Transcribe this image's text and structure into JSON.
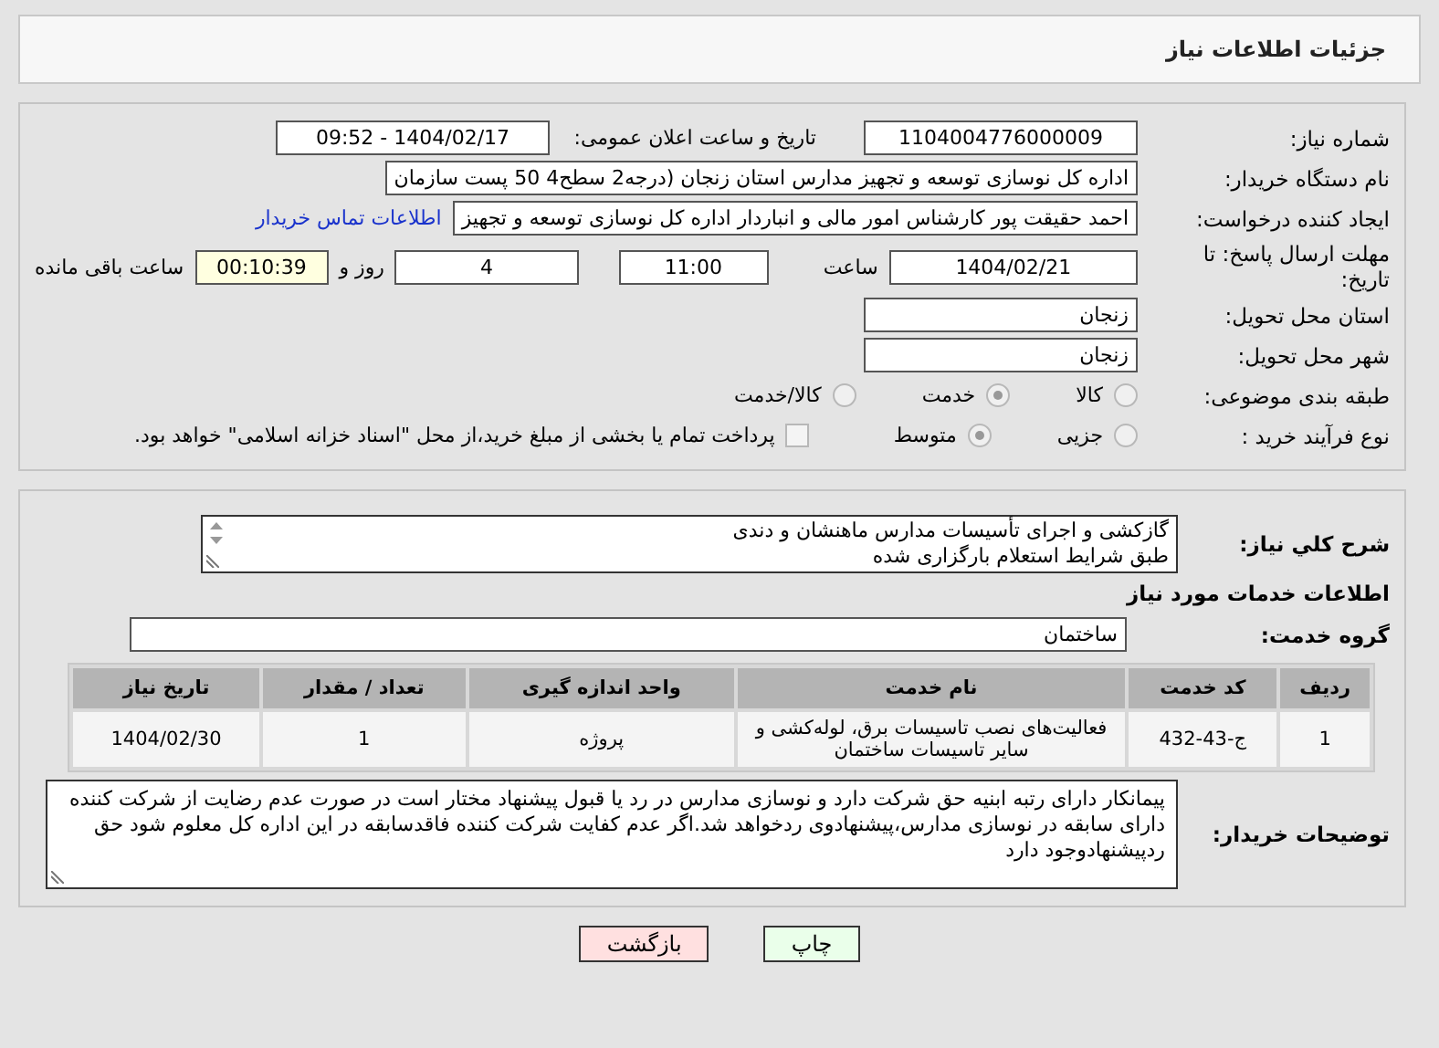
{
  "header": {
    "title": "جزئیات اطلاعات نیاز"
  },
  "details": {
    "need_number": {
      "label": "شماره نیاز:",
      "value": "1104004776000009"
    },
    "announce": {
      "label": "تاریخ و ساعت اعلان عمومی:",
      "value": "1404/02/17 - 09:52"
    },
    "buyer_org": {
      "label": "نام دستگاه خریدار:",
      "value": "اداره کل نوسازی   توسعه و تجهیز مدارس استان زنجان (درجه2  سطح4  50 پست سازمان"
    },
    "requester": {
      "label": "ایجاد کننده درخواست:",
      "value": "احمد حقیقت پور کارشناس امور مالی و انباردار اداره کل نوسازی   توسعه و تجهیز",
      "link": "اطلاعات تماس خریدار"
    },
    "deadline": {
      "label": "مهلت ارسال پاسخ: تا تاریخ:",
      "date": "1404/02/21",
      "time_label": "ساعت",
      "time": "11:00",
      "days": "4",
      "days_label": "روز و",
      "remaining": "00:10:39",
      "remaining_label": "ساعت باقی مانده"
    },
    "province": {
      "label": "استان محل تحویل:",
      "value": "زنجان"
    },
    "city": {
      "label": "شهر محل تحویل:",
      "value": "زنجان"
    },
    "category": {
      "label": "طبقه بندی موضوعی:",
      "options": [
        {
          "label": "کالا",
          "selected": false
        },
        {
          "label": "خدمت",
          "selected": true
        },
        {
          "label": "کالا/خدمت",
          "selected": false
        }
      ]
    },
    "process": {
      "label": "نوع فرآیند خرید :",
      "options": [
        {
          "label": "جزیی",
          "selected": false
        },
        {
          "label": "متوسط",
          "selected": true
        }
      ],
      "treasury": {
        "label": "پرداخت تمام یا بخشی از مبلغ خرید،از محل \"اسناد خزانه اسلامی\" خواهد بود.",
        "checked": false
      }
    }
  },
  "needs": {
    "description": {
      "label": "شرح كلي نياز:",
      "lines": [
        "گازکشی و اجرای تأسیسات مدارس ماهنشان و دندی",
        "طبق شرایط استعلام بارگزاری شده"
      ]
    },
    "section_title": "اطلاعات خدمات مورد نیاز",
    "service_group": {
      "label": "گروه خدمت:",
      "value": "ساختمان"
    },
    "table": {
      "columns": [
        "ردیف",
        "کد خدمت",
        "نام خدمت",
        "واحد اندازه گیری",
        "تعداد / مقدار",
        "تاریخ نیاز"
      ],
      "rows": [
        [
          "1",
          "ج-43-432",
          "فعالیت‌های نصب تاسیسات برق، لوله‌کشی و سایر تاسیسات ساختمان",
          "پروژه",
          "1",
          "1404/02/30"
        ]
      ]
    },
    "buyer_notes": {
      "label": "توضیحات خریدار:",
      "value": "پیمانکار دارای رتبه ابنیه حق شرکت دارد و نوسازی مدارس در رد یا قبول پیشنهاد مختار است در صورت عدم رضایت از شرکت کننده دارای سابقه در نوسازی مدارس،پیشنهادوی ردخواهد شد.اگر عدم کفایت شرکت کننده فاقدسابقه در این اداره کل معلوم شود حق ردپیشنهادوجود دارد"
    }
  },
  "buttons": [
    {
      "label": "چاپ",
      "kind": "print"
    },
    {
      "label": "بازگشت",
      "kind": "back"
    }
  ]
}
